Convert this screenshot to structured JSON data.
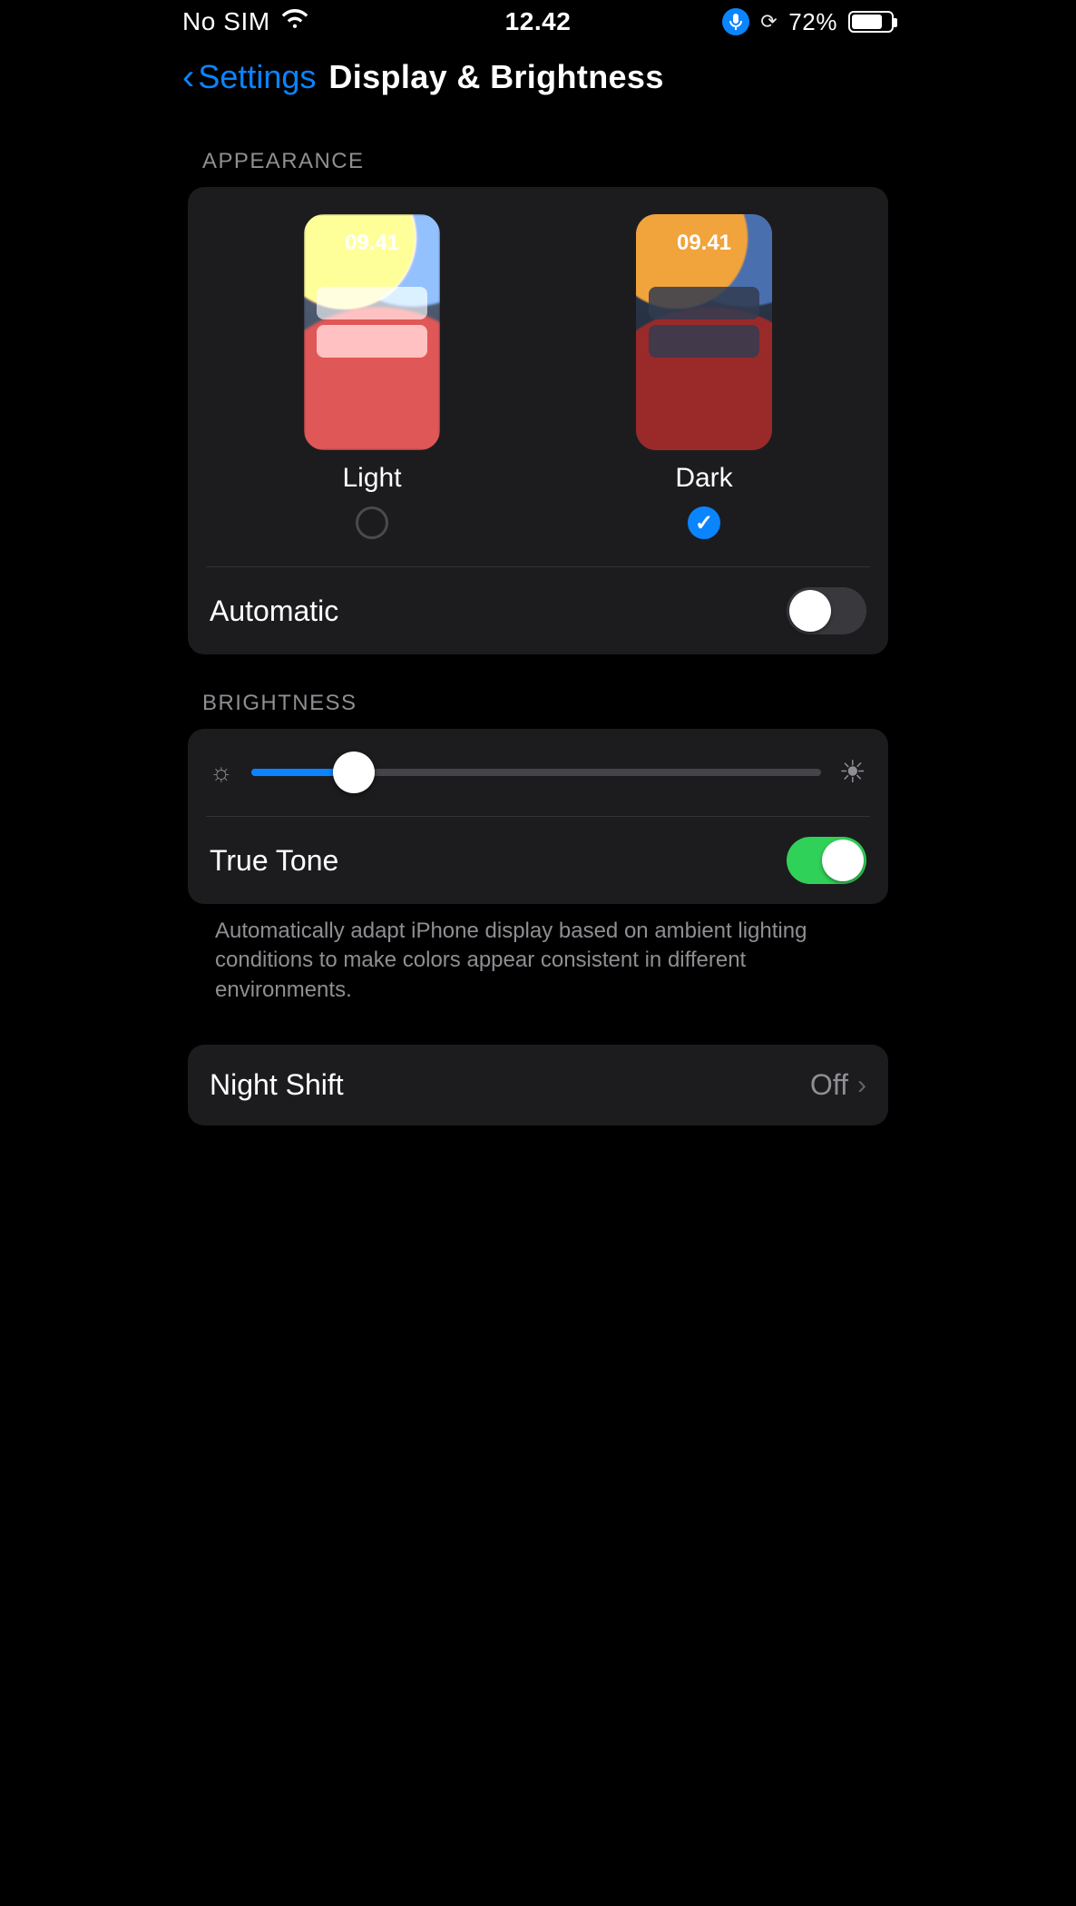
{
  "status": {
    "carrier": "No SIM",
    "time": "12.42",
    "battery_pct": "72%"
  },
  "nav": {
    "back_label": "Settings",
    "title": "Display & Brightness"
  },
  "appearance": {
    "header": "APPEARANCE",
    "light_label": "Light",
    "dark_label": "Dark",
    "thumb_time": "09.41",
    "selected": "dark",
    "automatic_label": "Automatic",
    "automatic_on": false
  },
  "brightness": {
    "header": "BRIGHTNESS",
    "level_pct": 20,
    "truetone_label": "True Tone",
    "truetone_on": true,
    "footer": "Automatically adapt iPhone display based on ambient lighting conditions to make colors appear consistent in different environments."
  },
  "night_shift": {
    "label": "Night Shift",
    "value": "Off"
  }
}
